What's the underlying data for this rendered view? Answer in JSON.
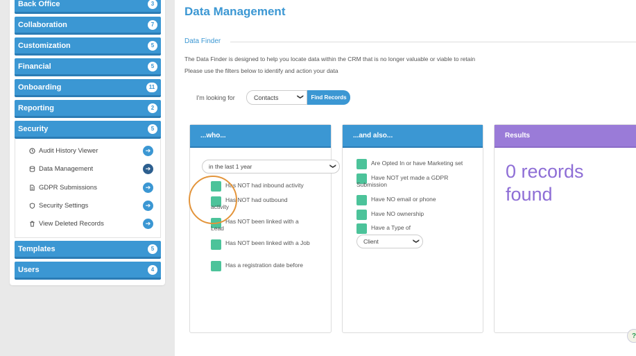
{
  "sidebar": {
    "items": [
      {
        "label": "Back Office",
        "badge": "3"
      },
      {
        "label": "Collaboration",
        "badge": "7"
      },
      {
        "label": "Customization",
        "badge": "5"
      },
      {
        "label": "Financial",
        "badge": "5"
      },
      {
        "label": "Onboarding",
        "badge": "11"
      },
      {
        "label": "Reporting",
        "badge": "2"
      },
      {
        "label": "Security",
        "badge": "5"
      },
      {
        "label": "Templates",
        "badge": "5"
      },
      {
        "label": "Users",
        "badge": "4"
      }
    ],
    "security_subitems": [
      {
        "label": "Audit History Viewer",
        "icon": "history-icon"
      },
      {
        "label": "Data Management",
        "icon": "database-icon"
      },
      {
        "label": "GDPR Submissions",
        "icon": "document-icon"
      },
      {
        "label": "Security Settings",
        "icon": "shield-icon"
      },
      {
        "label": "View Deleted Records",
        "icon": "trash-icon"
      }
    ]
  },
  "main": {
    "title": "Data Management",
    "section": "Data Finder",
    "description": [
      "The Data Finder is designed to help you locate data within the CRM that is no longer valuable or viable to retain",
      "Please use the filters below to identify and action your data"
    ],
    "looking_for_label": "I'm looking for",
    "type_select": "Contacts",
    "find_button": "Find Records"
  },
  "who_panel": {
    "title": "...who...",
    "timeframe": "in the last 1 year",
    "options": [
      "Has NOT had inbound activity",
      "Has NOT had outbound activity",
      "Has NOT been linked with a Lead",
      "Has NOT been linked with a Job",
      "Has a registration date before"
    ]
  },
  "also_panel": {
    "title": "...and also...",
    "options": [
      "Are Opted In or have Marketing set",
      "Have NOT yet made a GDPR Submission",
      "Have NO email or phone",
      "Have NO ownership",
      "Have a Type of"
    ],
    "type_select": "Client"
  },
  "results_panel": {
    "title": "Results",
    "text": "0 records found"
  },
  "colors": {
    "accent": "#3b97d3",
    "results": "#9a7bd8",
    "checkbox": "#4cc39a",
    "highlight": "#e3943a"
  }
}
